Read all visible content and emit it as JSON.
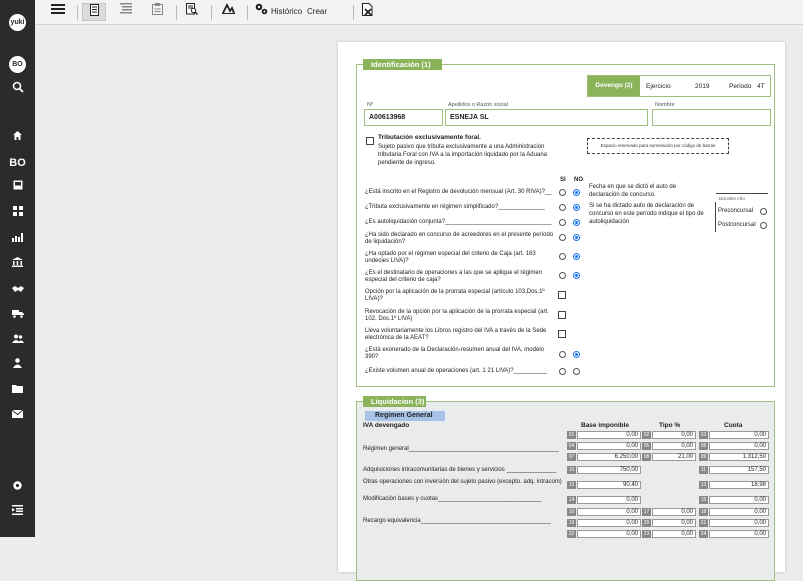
{
  "sidebar": {
    "logo": "yuki",
    "user_initials": "BO",
    "bo_label": "BO"
  },
  "toolbar": {
    "historico": "Histórico",
    "crear_archivo": "Crear Archivo"
  },
  "identificacion": {
    "title": "Identificación (1)",
    "devengo_label": "Devengo (2)",
    "ejercicio_label": "Ejercicio",
    "ejercicio_value": "2019",
    "periodo_label": "Periodo",
    "periodo_value": "4T",
    "nif_label": "Nº",
    "nif_value": "A00613968",
    "razon_label": "Apellidos o Razón social",
    "razon_value": "ESNEJA SL",
    "nombre_label": "Nombre",
    "nombre_value": "",
    "tributacion_title": "Tributación exclusivamente foral.",
    "tributacion_desc": "Sujeto pasivo que tributa exclusivamente a una Administracion tributaria Foral con IVA a la importación liquidado por la Aduana pendiente de ingreso.",
    "espacio_reservado": "Espacio reservado para numeración por código de barras",
    "si_label": "SI",
    "no_label": "NO",
    "questions": [
      {
        "text": "¿Está inscrito en el Registro de devolución mensual (Art. 30 RIVA)?__",
        "kind": "radio",
        "value": "no"
      },
      {
        "text": "¿Tributa exclusivamente en régimen simplificado?______________",
        "kind": "radio",
        "value": "no"
      },
      {
        "text": "¿Es autoliquidación conjunta?________________________________",
        "kind": "radio",
        "value": "no"
      },
      {
        "text": "¿Ha sido declarado en concurso de acreedores en el presente período de liquidación?",
        "kind": "radio",
        "value": "no"
      },
      {
        "text": "¿Ha optado por el régimen especial del criterio de Caja (art. 163 undecies LIVA)?",
        "kind": "radio",
        "value": "no"
      },
      {
        "text": "¿Es el destinatario de operaciones a las que se aplique el régimen especial del criterio de caja?",
        "kind": "radio",
        "value": "no"
      },
      {
        "text": "Opción por la aplicación de la prorrata especial (artículo 103.Dos.1º LIVA)?",
        "kind": "check",
        "value": false
      },
      {
        "text": "Revocación de la opción por la aplicación de la prorrata especial (art. 102. Dos.1º LIVA)",
        "kind": "check",
        "value": false
      },
      {
        "text": "Lleva voluntariamente los Libros registro del IVA a través de la Sede electrónica de la AEAT?",
        "kind": "check",
        "value": false
      },
      {
        "text": "¿Está exonerado de la Declaración-resumen anual del IVA, modelo 390?",
        "kind": "radio",
        "value": "no"
      },
      {
        "text": "¿Existe volumen anual de operaciones (art. 1 21 LIVA)?__________",
        "kind": "radio",
        "value": "none"
      }
    ],
    "fecha_auto_text": "Fecha en que se dictó el auto de declaración de concurso.",
    "dia_mes_anio": "Día Mes Año",
    "dictado_auto_text": "Si se ha dictado auto de declaración de concurso en este período indique el tipo de autoliquidación",
    "preconcursal": "Preconcursal",
    "postconcursal": "Postconcursal"
  },
  "liquidacion": {
    "title": "Liquidacion (3)",
    "regimen_general": "Regimen General",
    "iva_devengado": "IVA devengado",
    "col_base": "Base imponible",
    "col_tipo": "Tipo %",
    "col_cuota": "Cuota",
    "regimen_general_row": "Régimen general_____________________________________________",
    "rows_general": [
      {
        "b": "01",
        "base": "0,00",
        "t": "02",
        "tipo": "0,00",
        "c": "03",
        "cuota": "0,00"
      },
      {
        "b": "04",
        "base": "0,00",
        "t": "05",
        "tipo": "0,00",
        "c": "06",
        "cuota": "0,00"
      },
      {
        "b": "07",
        "base": "6.250,00",
        "t": "08",
        "tipo": "21,00",
        "c": "09",
        "cuota": "1.312,50"
      }
    ],
    "adq_label": "Adquisiciones intracomunitarias de bienes y servicios _______________",
    "adq": {
      "b": "10",
      "base": "750,00",
      "c": "11",
      "cuota": "157,50"
    },
    "otras_label": "Otras operaciones con inversión del sujeto pasivo (excepto. adq. intracom)",
    "otras": {
      "b": "12",
      "base": "90,40",
      "c": "13",
      "cuota": "18,98"
    },
    "modif_label": "Modificación bases y cuotas_______________________________",
    "modif": {
      "b": "14",
      "base": "0,00",
      "c": "15",
      "cuota": "0,00"
    },
    "recargo_label": "Recargo equivalencia_______________________________________",
    "rows_recargo": [
      {
        "b": "16",
        "base": "0,00",
        "t": "17",
        "tipo": "0,00",
        "c": "18",
        "cuota": "0,00"
      },
      {
        "b": "19",
        "base": "0,00",
        "t": "20",
        "tipo": "0,00",
        "c": "21",
        "cuota": "0,00"
      },
      {
        "b": "22",
        "base": "0,00",
        "t": "23",
        "tipo": "0,00",
        "c": "24",
        "cuota": "0,00"
      }
    ]
  }
}
